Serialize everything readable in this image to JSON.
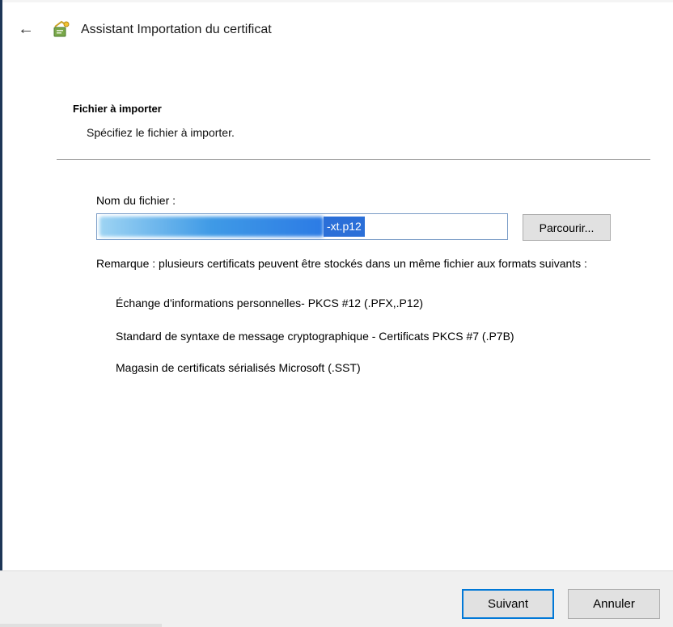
{
  "window": {
    "title": "Assistant Importation du certificat",
    "back_icon": "back-arrow-icon",
    "app_icon": "certificate-wizard-icon"
  },
  "section": {
    "heading": "Fichier à importer",
    "subheading": "Spécifiez le fichier à importer."
  },
  "file": {
    "label": "Nom du fichier :",
    "value_visible": "-xt.p12",
    "browse_label": "Parcourir..."
  },
  "note": {
    "text": "Remarque : plusieurs certificats peuvent être stockés dans un même fichier aux formats suivants :",
    "formats": [
      "Échange d'informations personnelles- PKCS #12 (.PFX,.P12)",
      "Standard de syntaxe de message cryptographique - Certificats PKCS #7 (.P7B)",
      "Magasin de certificats sérialisés Microsoft (.SST)"
    ]
  },
  "footer": {
    "next_label": "Suivant",
    "cancel_label": "Annuler"
  },
  "colors": {
    "accent": "#0078d7",
    "selection": "#2b6fd8",
    "footer_bg": "#f0f0f0"
  }
}
